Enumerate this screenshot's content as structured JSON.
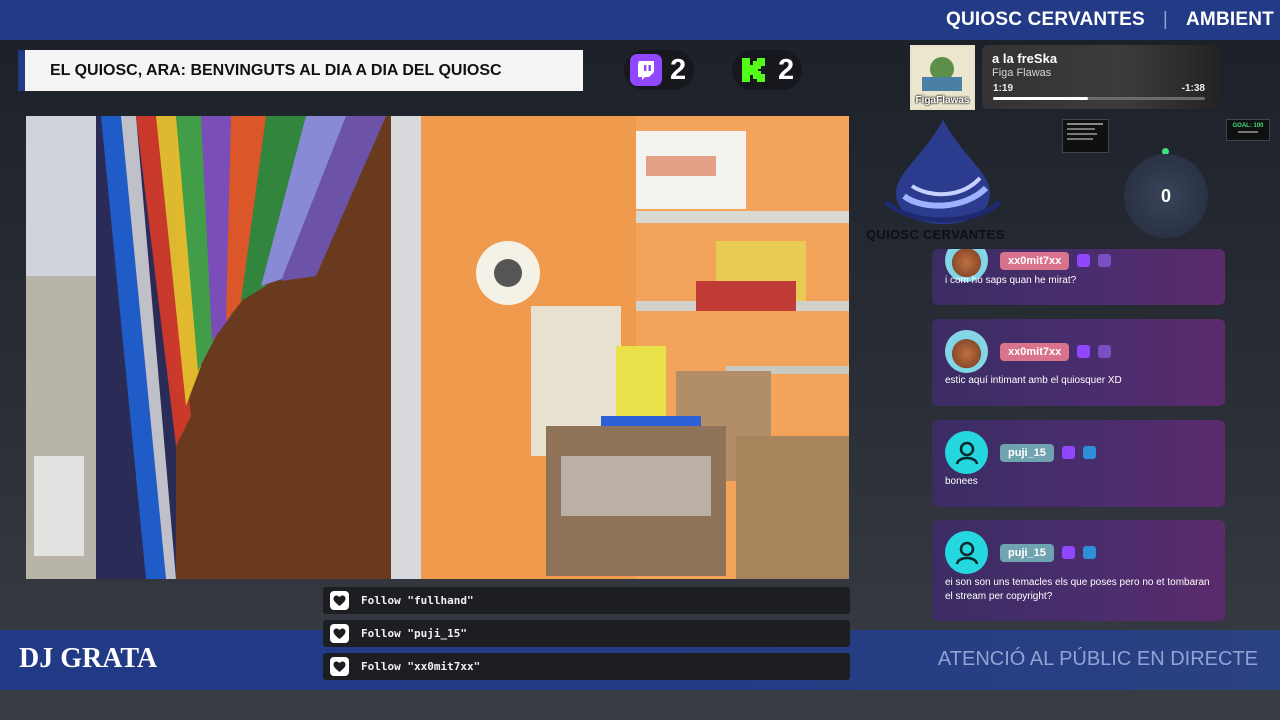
{
  "ticker": {
    "items": [
      "QUIOSC CERVANTES",
      "AMBIENT"
    ],
    "separator": "|"
  },
  "headline": "EL QUIOSC, ARA: BENVINGUTS AL DIA A DIA DEL QUIOSC",
  "counters": {
    "twitch": {
      "icon": "twitch-icon",
      "value": "2",
      "color": "#9146ff"
    },
    "kick": {
      "icon": "kick-icon",
      "value": "2",
      "color": "#53fc18"
    }
  },
  "now_playing": {
    "art_text": "FigaFlawas",
    "title": "a la freSka",
    "artist": "Figa Flawas",
    "elapsed": "1:19",
    "remaining": "-1:38",
    "progress": 0.45
  },
  "logo_text": "QUIOSC CERVANTES",
  "goal": {
    "label": "GOAL: 100"
  },
  "viewers": "0",
  "chat": [
    {
      "username": "xx0mit7xx",
      "avatar": "cat-avatar",
      "message": "i com ho saps quan he mirat?"
    },
    {
      "username": "xx0mit7xx",
      "avatar": "cat-avatar",
      "message": "estic aquí intimant amb el quiosquer XD"
    },
    {
      "username": "puji_15",
      "avatar": "user-icon",
      "message": "bonees"
    },
    {
      "username": "puji_15",
      "avatar": "user-icon",
      "message": "ei son son uns temacles els que poses pero no et tombaran el stream per copyright?"
    }
  ],
  "follows": [
    "Follow \"fullhand\"",
    "Follow \"puji_15\"",
    "Follow \"xx0mit7xx\""
  ],
  "bottom": {
    "dj": "DJ GRATA",
    "attention": "ATENCIÓ AL PÚBLIC EN DIRECTE"
  },
  "colors": {
    "brand_blue": "#233a86",
    "chat_bg": "#4a2d6e",
    "cyan_avatar": "#25d8e0",
    "pink_name": "#d9738c"
  }
}
